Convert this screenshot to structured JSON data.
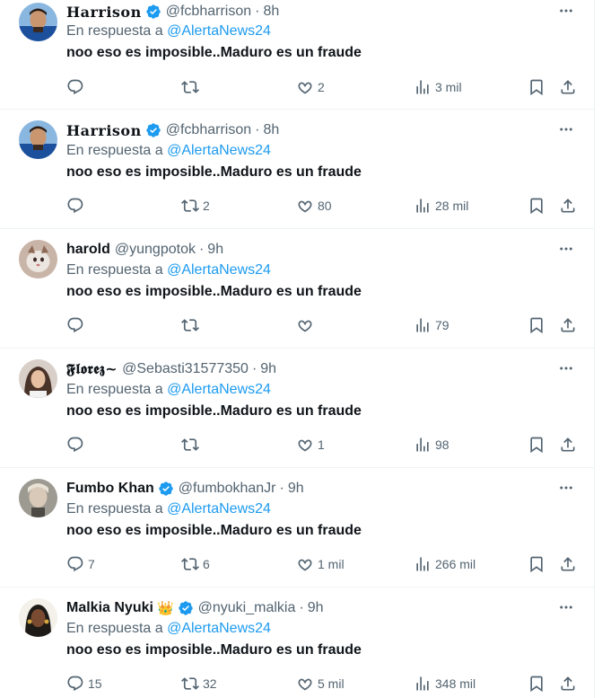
{
  "reply_prefix": "En respuesta a",
  "tweets": [
    {
      "name": "Harrison",
      "verified": true,
      "crown": false,
      "handle": "@fcbharrison",
      "time": "8h",
      "replying_to": "@AlertaNews24",
      "text": "noo eso es imposible..Maduro es un fraude",
      "replies": "",
      "retweets": "",
      "likes": "2",
      "views": "3 mil"
    },
    {
      "name": "Harrison",
      "verified": true,
      "crown": false,
      "handle": "@fcbharrison",
      "time": "8h",
      "replying_to": "@AlertaNews24",
      "text": "noo eso es imposible..Maduro es un fraude",
      "replies": "",
      "retweets": "2",
      "likes": "80",
      "views": "28 mil"
    },
    {
      "name": "harold",
      "verified": false,
      "crown": false,
      "handle": "@yungpotok",
      "time": "9h",
      "replying_to": "@AlertaNews24",
      "text": "noo eso es imposible..Maduro es un fraude",
      "replies": "",
      "retweets": "",
      "likes": "",
      "views": "79"
    },
    {
      "name": "𝕱𝖑𝖔𝖗𝖊𝖟~",
      "verified": false,
      "crown": false,
      "handle": "@Sebasti31577350",
      "time": "9h",
      "replying_to": "@AlertaNews24",
      "text": "noo eso es imposible..Maduro es un fraude",
      "replies": "",
      "retweets": "",
      "likes": "1",
      "views": "98"
    },
    {
      "name": "Fumbo Khan",
      "verified": true,
      "crown": false,
      "handle": "@fumbokhanJr",
      "time": "9h",
      "replying_to": "@AlertaNews24",
      "text": "noo eso es imposible..Maduro es un fraude",
      "replies": "7",
      "retweets": "6",
      "likes": "1 mil",
      "views": "266 mil"
    },
    {
      "name": "Malkia Nyuki",
      "verified": true,
      "crown": true,
      "handle": "@nyuki_malkia",
      "time": "9h",
      "replying_to": "@AlertaNews24",
      "text": "noo eso es imposible..Maduro es un fraude",
      "replies": "15",
      "retweets": "32",
      "likes": "5 mil",
      "views": "348 mil"
    }
  ],
  "colors": {
    "text": "#0f1419",
    "secondary": "#536471",
    "link": "#1d9bf0",
    "verified": "#1d9bf0",
    "divider": "#eff3f4"
  },
  "icons": {
    "reply": "reply-icon",
    "retweet": "retweet-icon",
    "like": "heart-icon",
    "views": "views-icon",
    "bookmark": "bookmark-icon",
    "share": "share-icon",
    "more": "more-icon",
    "verified": "verified-badge-icon",
    "crown": "crown-icon"
  }
}
